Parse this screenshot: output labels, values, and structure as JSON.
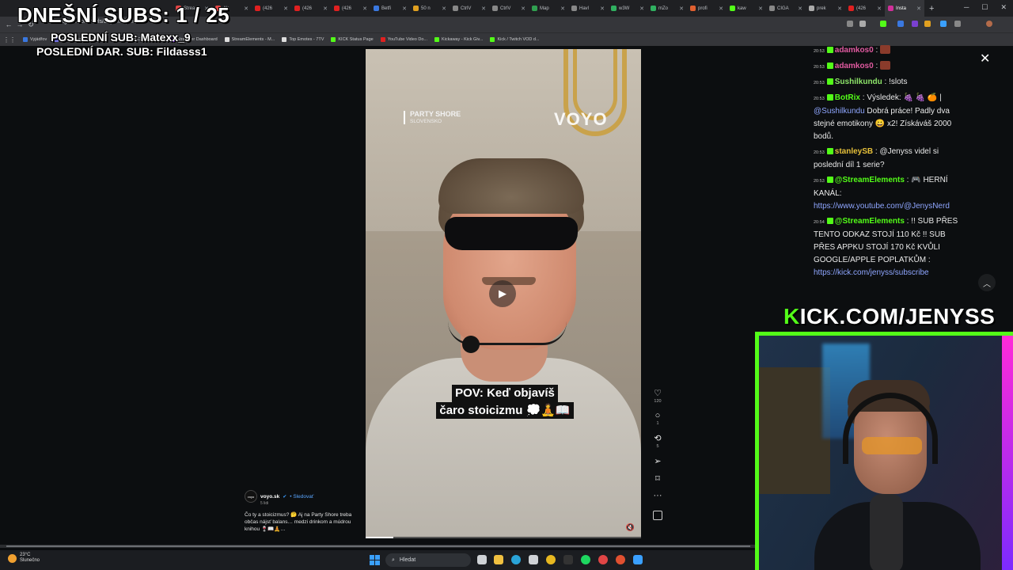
{
  "browser": {
    "tabs": [
      {
        "label": "Strea",
        "color": "#e04545"
      },
      {
        "label": "Ak",
        "color": "#e04545"
      },
      {
        "label": "(426",
        "color": "#e02020"
      },
      {
        "label": "(426",
        "color": "#e02020"
      },
      {
        "label": "(426",
        "color": "#e02020"
      },
      {
        "label": "Betfi",
        "color": "#3a78e0"
      },
      {
        "label": "50 n",
        "color": "#e0a020"
      },
      {
        "label": "CtrlV",
        "color": "#888888"
      },
      {
        "label": "CtrlV",
        "color": "#888888"
      },
      {
        "label": "Map",
        "color": "#30a050"
      },
      {
        "label": "Havl",
        "color": "#888888"
      },
      {
        "label": "w3W",
        "color": "#30b060"
      },
      {
        "label": "mZo",
        "color": "#30b060"
      },
      {
        "label": "profi",
        "color": "#e06030"
      },
      {
        "label": "kaw",
        "color": "#53fc18"
      },
      {
        "label": "CIGA",
        "color": "#888888"
      },
      {
        "label": "prek",
        "color": "#aaaaaa"
      },
      {
        "label": "(426",
        "color": "#e02020"
      },
      {
        "label": "Insta",
        "color": "#d0309a"
      }
    ],
    "url": "instagram.com/reels/DbjAmVfyCiA/",
    "bookmarks": [
      {
        "label": "Vyjádřov",
        "color": "#3a78e0"
      },
      {
        "label": "File Converter - Free...",
        "color": "#7070e0"
      },
      {
        "label": "The best ChatBot an...",
        "color": "#dddddd"
      },
      {
        "label": "Streamer Dashboard",
        "color": "#7a40d0"
      },
      {
        "label": "StreamElements - M...",
        "color": "#dddddd"
      },
      {
        "label": "Top Emotes - 7TV",
        "color": "#dddddd"
      },
      {
        "label": "KICK Status Page",
        "color": "#53fc18"
      },
      {
        "label": "YouTube Video Do...",
        "color": "#e02020"
      },
      {
        "label": "Kickaway - Kick Giv...",
        "color": "#53fc18"
      },
      {
        "label": "Kick / Twitch VOD d...",
        "color": "#53fc18"
      }
    ]
  },
  "overlay": {
    "subs_today": "DNEŠNÍ SUBS: 1 / 25",
    "last_sub": "POSLEDNÍ SUB: Matexx_9",
    "last_dar_sub": "POSLEDNÍ DAR. SUB: Fildasss1"
  },
  "reel": {
    "watermark_left": "PARTY SHORE",
    "watermark_left_sub": "SLOVENSKO",
    "watermark_right": "VOYO",
    "caption_line1": "POV: Keď objavíš",
    "caption_line2": "čaro stoicizmu 💭🧘📖",
    "progress": 0.1,
    "actions": {
      "likes": "120",
      "comments": "1",
      "shares": "5"
    },
    "author": {
      "avatar": "voyo",
      "username": "voyo.sk",
      "follow": "• Sledovať",
      "likes_line": "5 lidi",
      "description": "Čo ty a stoicizmus? 🤔 Aj na Party Shore treba občas nájsť balans… medzi drinkom a múdrou knihou 🍷📖🧘…"
    }
  },
  "chat": {
    "messages": [
      {
        "time": "20:53",
        "user": "adamkos0",
        "user_color": "#e05aa0",
        "text": " : ",
        "emote": true
      },
      {
        "time": "20:53",
        "user": "adamkos0",
        "user_color": "#e05aa0",
        "text": " : ",
        "emote": true
      },
      {
        "time": "20:53",
        "user": "Sushilkundu",
        "user_color": "#8ee56a",
        "text": " : !slots"
      },
      {
        "time": "20:53",
        "user": "BotRix",
        "user_color": "#53fc18",
        "text": " : Výsledek: 🍇 🍇 🍊 | ",
        "link": "@Sushilkundu",
        "text2": " Dobrá práce! Padly dva stejné emotikony 😀 x2! Získáváš 2000 bodů."
      },
      {
        "time": "20:53",
        "user": "stanleySB",
        "user_color": "#e6c03a",
        "text": " : @Jenyss videl si poslední díl 1 serie?"
      },
      {
        "time": "20:53",
        "user": "@StreamElements",
        "user_color": "#53fc18",
        "text": " : 🎮 HERNÍ KANÁL: ",
        "link": "https://www.youtube.com/@JenysNerd"
      },
      {
        "time": "20:54",
        "user": "@StreamElements",
        "user_color": "#53fc18",
        "text": " : !! SUB PŘES TENTO ODKAZ STOJÍ 110 Kč !! SUB PŘES APPKU STOJÍ 170 Kč KVŮLI GOOGLE/APPLE POPLATKŮM : ",
        "link": "https://kick.com/jenyss/subscribe"
      }
    ]
  },
  "webcam": {
    "kick_prefix": "K",
    "kick_rest": "ICK.COM/JENYSS",
    "accent": "#53fc18"
  },
  "taskbar": {
    "temperature": "23°C",
    "weather": "Slunečno",
    "search_placeholder": "Hledat"
  }
}
